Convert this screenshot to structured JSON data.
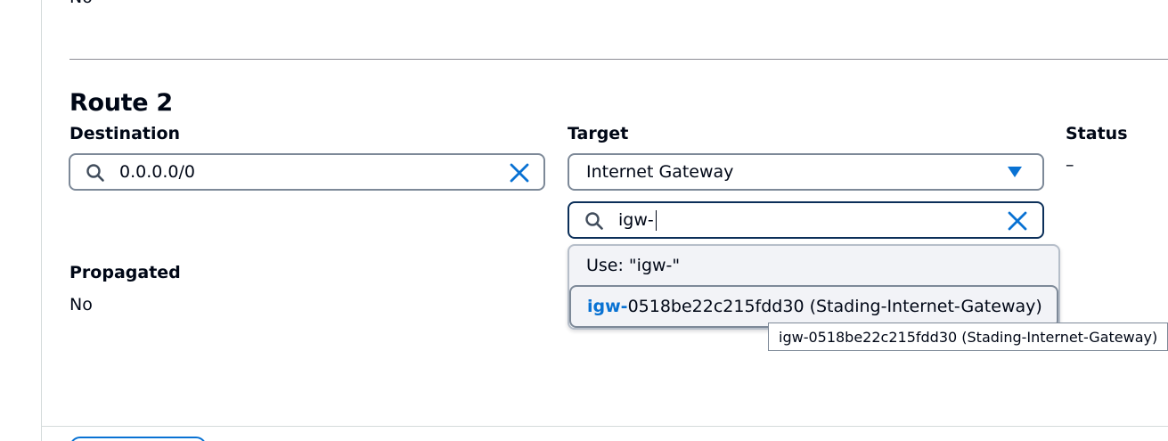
{
  "previous_section": {
    "value": "No"
  },
  "route": {
    "title": "Route 2",
    "destination": {
      "label": "Destination",
      "value": "0.0.0.0/0"
    },
    "target": {
      "label": "Target",
      "selected": "Internet Gateway",
      "search_value": "igw-",
      "options": [
        {
          "label": "Use: \"igw-\""
        },
        {
          "match": "igw-",
          "rest": "0518be22c215fdd30 (Stading-Internet-Gateway)"
        }
      ],
      "tooltip": "igw-0518be22c215fdd30 (Stading-Internet-Gateway)"
    },
    "status": {
      "label": "Status",
      "value": "–"
    },
    "propagated": {
      "label": "Propagated",
      "value": "No"
    }
  },
  "icons": {
    "search": "search-icon",
    "clear": "close-icon",
    "caret": "caret-down-icon"
  },
  "colors": {
    "accent": "#0972d3",
    "focus_border": "#0b2f59",
    "input_border": "#7d8998",
    "dropdown_bg": "#f2f3f7"
  }
}
